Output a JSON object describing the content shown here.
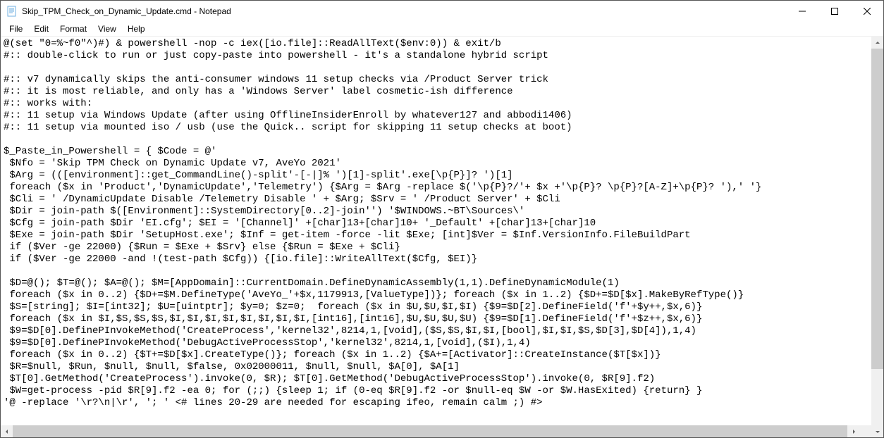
{
  "window": {
    "title": "Skip_TPM_Check_on_Dynamic_Update.cmd - Notepad"
  },
  "menu": {
    "file": "File",
    "edit": "Edit",
    "format": "Format",
    "view": "View",
    "help": "Help"
  },
  "controls": {
    "minimize": "─",
    "maximize": "☐",
    "close": "✕"
  },
  "content": {
    "text": "@(set \"0=%~f0\"^)#) & powershell -nop -c iex([io.file]::ReadAllText($env:0)) & exit/b\n#:: double-click to run or just copy-paste into powershell - it's a standalone hybrid script\n\n#:: v7 dynamically skips the anti-consumer windows 11 setup checks via /Product Server trick\n#:: it is most reliable, and only has a 'Windows Server' label cosmetic-ish difference\n#:: works with:\n#:: 11 setup via Windows Update (after using OfflineInsiderEnroll by whatever127 and abbodi1406)\n#:: 11 setup via mounted iso / usb (use the Quick.. script for skipping 11 setup checks at boot)\n\n$_Paste_in_Powershell = { $Code = @'\n $Nfo = 'Skip TPM Check on Dynamic Update v7, AveYo 2021'\n $Arg = (([environment]::get_CommandLine()-split'-[-|]% ')[1]-split'.exe[\\p{P}]? ')[1]\n foreach ($x in 'Product','DynamicUpdate','Telemetry') {$Arg = $Arg -replace $('\\p{P}?/'+ $x +'\\p{P}? \\p{P}?[A-Z]+\\p{P}? '),' '}\n $Cli = ' /DynamicUpdate Disable /Telemetry Disable ' + $Arg; $Srv = ' /Product Server' + $Cli\n $Dir = join-path $([Environment]::SystemDirectory[0..2]-join'') '$WINDOWS.~BT\\Sources\\'\n $Cfg = join-path $Dir 'EI.cfg'; $EI = '[Channel]' +[char]13+[char]10+ '_Default' +[char]13+[char]10\n $Exe = join-path $Dir 'SetupHost.exe'; $Inf = get-item -force -lit $Exe; [int]$Ver = $Inf.VersionInfo.FileBuildPart\n if ($Ver -ge 22000) {$Run = $Exe + $Srv} else {$Run = $Exe + $Cli}\n if ($Ver -ge 22000 -and !(test-path $Cfg)) {[io.file]::WriteAllText($Cfg, $EI)}\n\n $D=@(); $T=@(); $A=@(); $M=[AppDomain]::CurrentDomain.DefineDynamicAssembly(1,1).DefineDynamicModule(1)\n foreach ($x in 0..2) {$D+=$M.DefineType('AveYo_'+$x,1179913,[ValueType])}; foreach ($x in 1..2) {$D+=$D[$x].MakeByRefType()}\n $S=[string]; $I=[int32]; $U=[uintptr]; $y=0; $z=0;  foreach ($x in $U,$U,$I,$I) {$9=$D[2].DefineField('f'+$y++,$x,6)}\n foreach ($x in $I,$S,$S,$S,$I,$I,$I,$I,$I,$I,$I,$I,[int16],[int16],$U,$U,$U,$U) {$9=$D[1].DefineField('f'+$z++,$x,6)}\n $9=$D[0].DefinePInvokeMethod('CreateProcess','kernel32',8214,1,[void],($S,$S,$I,$I,[bool],$I,$I,$S,$D[3],$D[4]),1,4)\n $9=$D[0].DefinePInvokeMethod('DebugActiveProcessStop','kernel32',8214,1,[void],($I),1,4)\n foreach ($x in 0..2) {$T+=$D[$x].CreateType()}; foreach ($x in 1..2) {$A+=[Activator]::CreateInstance($T[$x])}\n $R=$null, $Run, $null, $null, $false, 0x02000011, $null, $null, $A[0], $A[1]\n $T[0].GetMethod('CreateProcess').invoke(0, $R); $T[0].GetMethod('DebugActiveProcessStop').invoke(0, $R[9].f2)\n $W=get-process -pid $R[9].f2 -ea 0; for (;;) {sleep 1; if (0-eq $R[9].f2 -or $null-eq $W -or $W.HasExited) {return} }\n'@ -replace '\\r?\\n|\\r', '; ' <# lines 20-29 are needed for escaping ifeo, remain calm ;) #>"
  }
}
